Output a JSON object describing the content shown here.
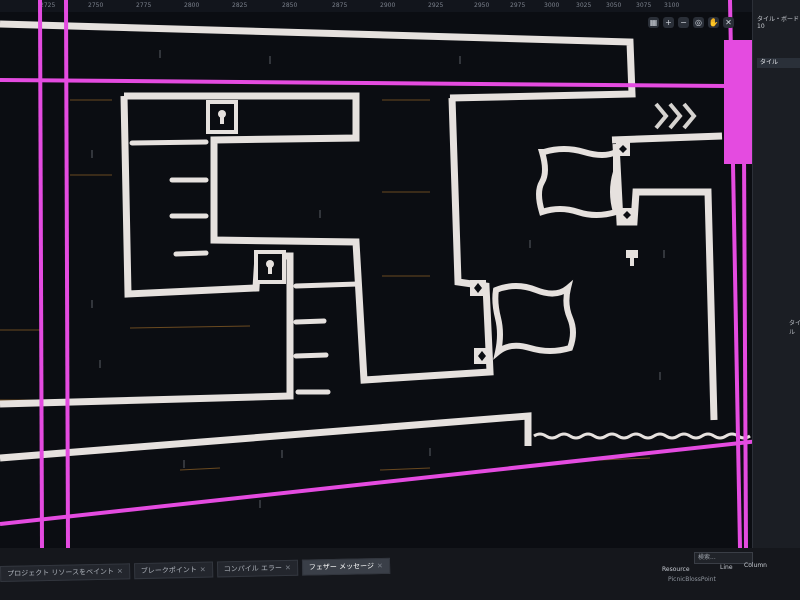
{
  "ruler": {
    "ticks": [
      "2725",
      "2750",
      "2775",
      "2800",
      "2825",
      "2850",
      "2875",
      "2900",
      "2925",
      "2950",
      "2975",
      "3000",
      "3025",
      "3050",
      "3075",
      "3100"
    ]
  },
  "toolbar": {
    "grid_icon": "grid-icon",
    "zoom_in_icon": "zoom-in-icon",
    "zoom_out_icon": "zoom-out-icon",
    "zoom_fit_icon": "zoom-fit-icon",
    "hand_icon": "hand-icon",
    "close_icon": "close-icon"
  },
  "tile_panel": {
    "title": "タイル・ボード10",
    "tab": "タイル",
    "side_label": "タイル"
  },
  "bottom_tabs": [
    {
      "label": "プロジェクト リソースをペイント"
    },
    {
      "label": "ブレークポイント"
    },
    {
      "label": "コンパイル エラー"
    },
    {
      "label": "フェザー メッセージ"
    }
  ],
  "resource_panel": {
    "label": "Resource",
    "search_placeholder": "検索...",
    "line_label": "Line",
    "column_label": "Column",
    "item_name": "PicnicBlossPoint"
  },
  "colors": {
    "background": "#0b0d12",
    "wall": "#e8e4e2",
    "magenta": "#e44be0",
    "panel": "#1b1e24"
  }
}
